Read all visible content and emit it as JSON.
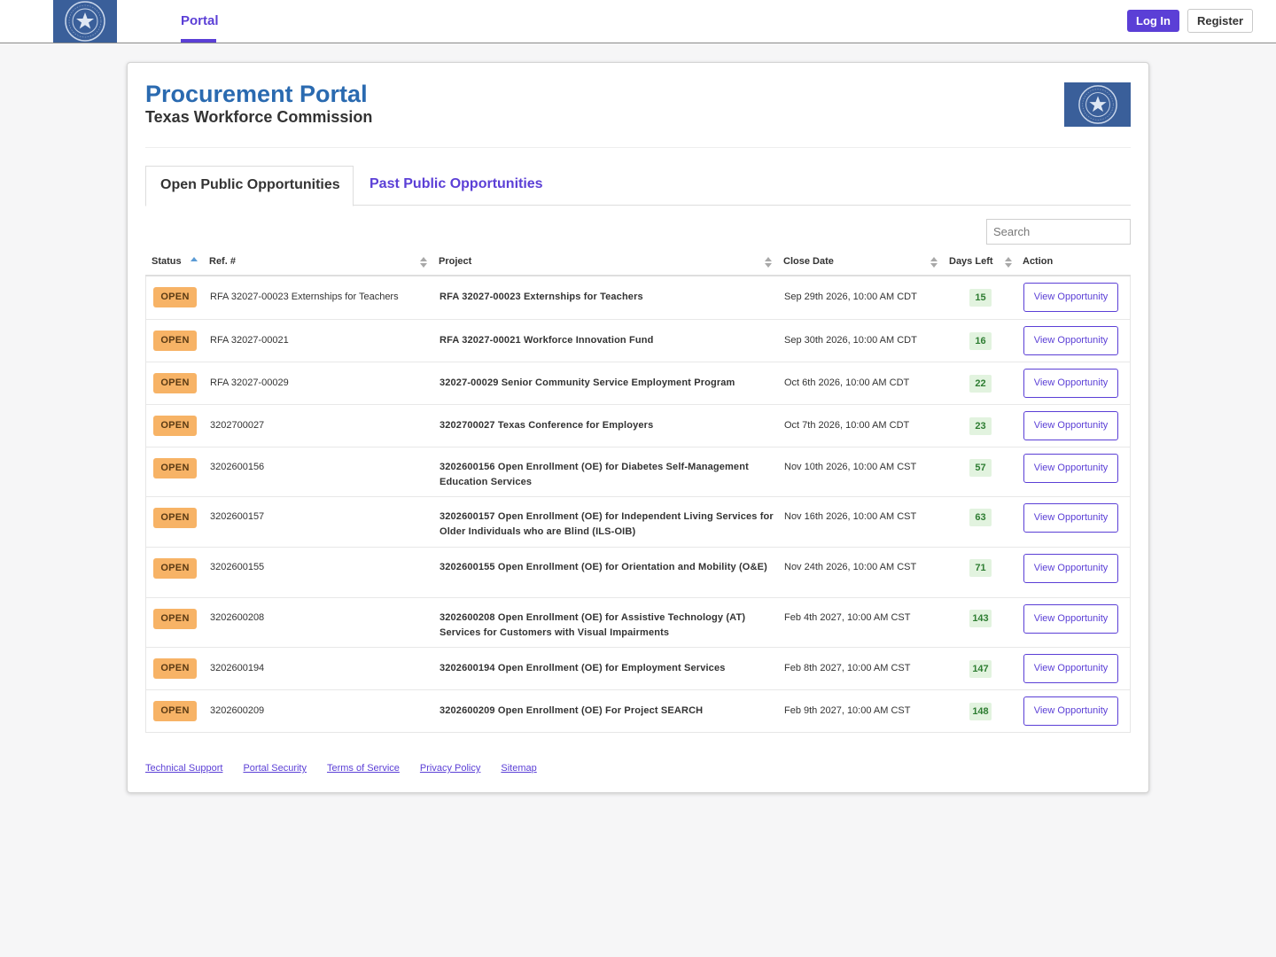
{
  "topnav": {
    "tab_label": "Portal",
    "login_label": "Log In",
    "register_label": "Register"
  },
  "header": {
    "title": "Procurement Portal",
    "subtitle": "Texas Workforce Commission"
  },
  "tabs": [
    {
      "label": "Open Public Opportunities",
      "active": true
    },
    {
      "label": "Past Public Opportunities",
      "active": false
    }
  ],
  "search": {
    "placeholder": "Search",
    "value": ""
  },
  "table": {
    "columns": [
      "Status",
      "Ref. #",
      "Project",
      "Close Date",
      "Days Left",
      "Action"
    ],
    "sorted_by": "Status",
    "sort_direction": "ascending",
    "rows": [
      {
        "status": "OPEN",
        "ref": "RFA 32027-00023 Externships for Teachers",
        "project": "RFA 32027-00023 Externships for Teachers",
        "close_date": "Sep 29th 2026, 10:00 AM CDT",
        "days_left": "15",
        "action": "View Opportunity"
      },
      {
        "status": "OPEN",
        "ref": "RFA 32027-00021",
        "project": "RFA 32027-00021 Workforce Innovation Fund",
        "close_date": "Sep 30th 2026, 10:00 AM CDT",
        "days_left": "16",
        "action": "View Opportunity"
      },
      {
        "status": "OPEN",
        "ref": "RFA 32027-00029",
        "project": "32027-00029 Senior Community Service Employment Program",
        "close_date": "Oct 6th 2026, 10:00 AM CDT",
        "days_left": "22",
        "action": "View Opportunity"
      },
      {
        "status": "OPEN",
        "ref": "3202700027",
        "project": "3202700027 Texas Conference for Employers",
        "close_date": "Oct 7th 2026, 10:00 AM CDT",
        "days_left": "23",
        "action": "View Opportunity"
      },
      {
        "status": "OPEN",
        "ref": "3202600156",
        "project": "3202600156 Open Enrollment (OE) for Diabetes Self-Management Education Services",
        "close_date": "Nov 10th 2026, 10:00 AM CST",
        "days_left": "57",
        "action": "View Opportunity"
      },
      {
        "status": "OPEN",
        "ref": "3202600157",
        "project": "3202600157 Open Enrollment (OE) for Independent Living Services for Older Individuals who are Blind (ILS-OIB)",
        "close_date": "Nov 16th 2026, 10:00 AM CST",
        "days_left": "63",
        "action": "View Opportunity"
      },
      {
        "status": "OPEN",
        "ref": "3202600155",
        "project": "3202600155 Open Enrollment (OE) for Orientation and Mobility (O&E)",
        "close_date": "Nov 24th 2026, 10:00 AM CST",
        "days_left": "71",
        "action": "View Opportunity"
      },
      {
        "status": "OPEN",
        "ref": "3202600208",
        "project": "3202600208 Open Enrollment (OE) for Assistive Technology (AT) Services for Customers with Visual Impairments",
        "close_date": "Feb 4th 2027, 10:00 AM CST",
        "days_left": "143",
        "action": "View Opportunity"
      },
      {
        "status": "OPEN",
        "ref": "3202600194",
        "project": "3202600194 Open Enrollment (OE) for Employment Services",
        "close_date": "Feb 8th 2027, 10:00 AM CST",
        "days_left": "147",
        "action": "View Opportunity"
      },
      {
        "status": "OPEN",
        "ref": "3202600209",
        "project": "3202600209 Open Enrollment (OE) For Project SEARCH",
        "close_date": "Feb 9th 2027, 10:00 AM CST",
        "days_left": "148",
        "action": "View Opportunity"
      }
    ]
  },
  "footer": {
    "links": [
      "Technical Support",
      "Portal Security",
      "Terms of Service",
      "Privacy Policy",
      "Sitemap"
    ]
  },
  "colors": {
    "accent": "#5b3fd6",
    "title": "#2a6ab0",
    "status_badge": "#f7b366",
    "days_badge": "#e2f3df",
    "logo_background": "#3a5f9a"
  },
  "icons": [
    "texas-workforce-seal-icon",
    "sort-ascending-icon",
    "sort-both-icon"
  ]
}
